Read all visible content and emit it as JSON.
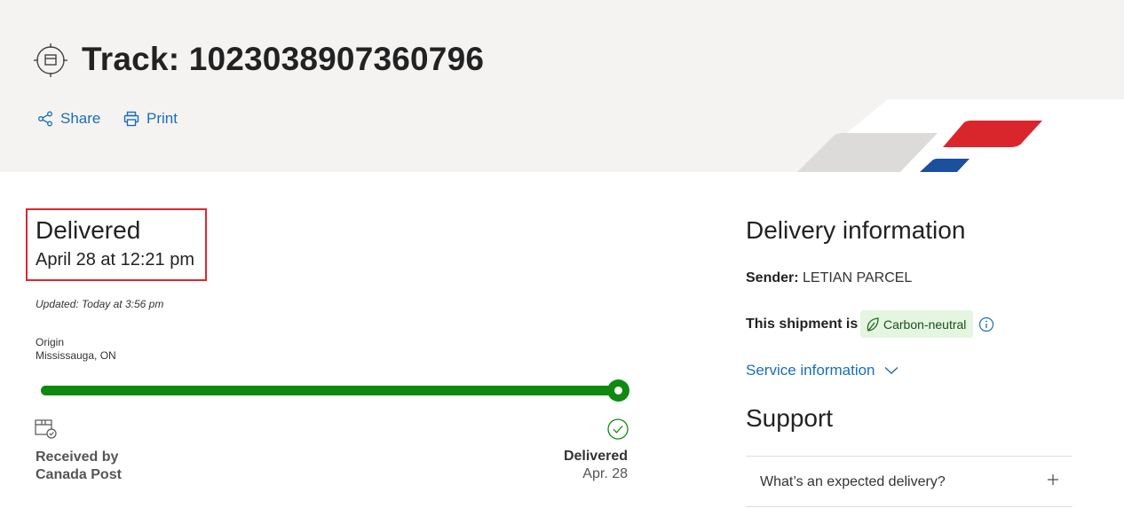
{
  "header": {
    "title": "Track: 1023038907360796",
    "actions": {
      "share": "Share",
      "print": "Print"
    }
  },
  "status": {
    "title": "Delivered",
    "date": "April 28 at 12:21 pm",
    "updated": "Updated: Today at 3:56 pm"
  },
  "origin": {
    "label": "Origin",
    "value": "Mississauga, ON"
  },
  "progress": {
    "fraction": 1.0
  },
  "milestones": {
    "start_line1": "Received by",
    "start_line2": "Canada Post",
    "end_label": "Delivered",
    "end_date": "Apr. 28"
  },
  "delivery_info": {
    "title": "Delivery information",
    "sender_label": "Sender:",
    "sender_value": "LETIAN PARCEL",
    "shipment_label": "This shipment is",
    "carbon_badge": "Carbon-neutral",
    "service_link": "Service information"
  },
  "support": {
    "title": "Support",
    "faq_question": "What’s an expected delivery?"
  },
  "colors": {
    "accent": "#1a6fb5",
    "progress": "#0f8a0f",
    "highlight": "#e0262c",
    "badge_bg": "#e4f5e0"
  },
  "icons": [
    "tracking-target-icon",
    "share-icon",
    "print-icon",
    "parcel-icon",
    "check-circle-icon",
    "leaf-icon",
    "info-icon",
    "chevron-down-icon",
    "plus-icon"
  ]
}
